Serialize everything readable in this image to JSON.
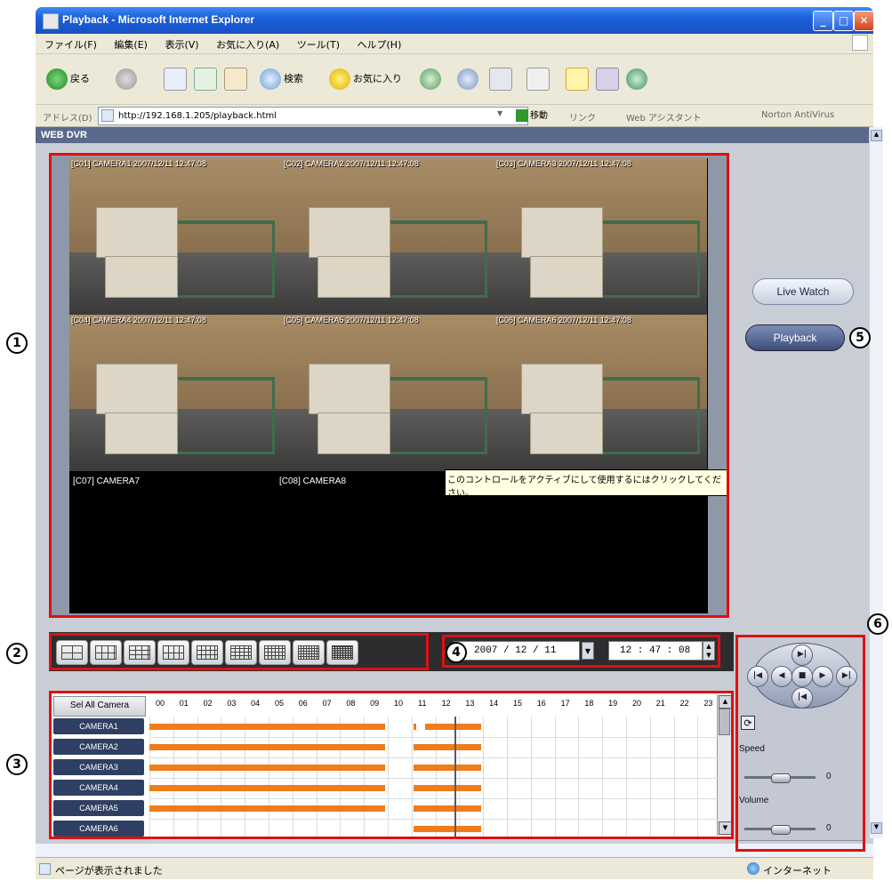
{
  "window": {
    "title": "Playback - Microsoft Internet Explorer",
    "minimize": "_",
    "maximize": "□",
    "close": "✕"
  },
  "menu": [
    "ファイル(F)",
    "編集(E)",
    "表示(V)",
    "お気に入り(A)",
    "ツール(T)",
    "ヘルプ(H)"
  ],
  "toolbar": {
    "back": "戻る",
    "search": "検索",
    "favorites": "お気に入り"
  },
  "address": {
    "label": "アドレス(D)",
    "url": "http://192.168.1.205/playback.html",
    "go": "移動",
    "links": "リンク",
    "assistant": "Web アシスタント",
    "norton": "Norton AntiVirus"
  },
  "page": {
    "header": "WEB DVR"
  },
  "cameras": [
    {
      "label": "[C01] CAMERA1  2007/12/11  12:47:08"
    },
    {
      "label": "[C02] CAMERA2  2007/12/11  12:47:08"
    },
    {
      "label": "[C03] CAMERA3  2007/12/11  12:47:08"
    },
    {
      "label": "[C04] CAMERA4  2007/12/11  12:47:08"
    },
    {
      "label": "[C05] CAMERA5  2007/12/11  12:47:08"
    },
    {
      "label": "[C06] CAMERA6  2007/12/11  12:47:08"
    }
  ],
  "blank_cameras": [
    "[C07] CAMERA7",
    "[C08] CAMERA8"
  ],
  "tooltip": "このコントロールをアクティブにして使用するにはクリックしてください。",
  "side_buttons": {
    "live": "Live Watch",
    "playback": "Playback"
  },
  "date": {
    "year": "2007",
    "month": "12",
    "day": "11",
    "display": "2007 / 12 / 11"
  },
  "time": {
    "display": "12 : 47 : 08"
  },
  "timeline": {
    "select_all": "Sel All Camera",
    "hours": [
      "00",
      "01",
      "02",
      "03",
      "04",
      "05",
      "06",
      "07",
      "08",
      "09",
      "10",
      "11",
      "12",
      "13",
      "14",
      "15",
      "16",
      "17",
      "18",
      "19",
      "20",
      "21",
      "22",
      "23"
    ],
    "rows": [
      {
        "name": "CAMERA1",
        "segments": [
          [
            0,
            9.9
          ],
          [
            11.1,
            11.2
          ],
          [
            11.55,
            13.9
          ]
        ]
      },
      {
        "name": "CAMERA2",
        "segments": [
          [
            0,
            9.9
          ],
          [
            11.1,
            13.9
          ]
        ]
      },
      {
        "name": "CAMERA3",
        "segments": [
          [
            0,
            9.9
          ],
          [
            11.1,
            13.9
          ]
        ]
      },
      {
        "name": "CAMERA4",
        "segments": [
          [
            0,
            9.9
          ],
          [
            11.1,
            13.9
          ]
        ]
      },
      {
        "name": "CAMERA5",
        "segments": [
          [
            0,
            9.9
          ],
          [
            11.1,
            13.9
          ]
        ]
      },
      {
        "name": "CAMERA6",
        "segments": [
          [
            11.1,
            13.9
          ]
        ]
      }
    ],
    "current_hour": 12.79
  },
  "controls": {
    "speed_label": "Speed",
    "speed_value": "0",
    "volume_label": "Volume",
    "volume_value": "0"
  },
  "status": {
    "left": "ページが表示されました",
    "right": "インターネット"
  },
  "callouts": [
    "1",
    "2",
    "3",
    "4",
    "5",
    "6"
  ]
}
